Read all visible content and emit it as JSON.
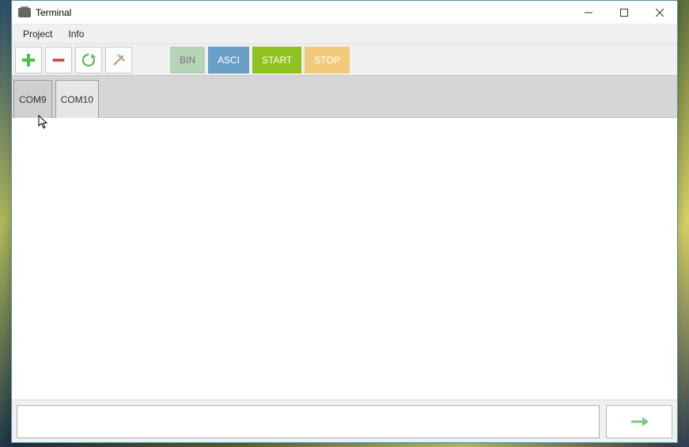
{
  "window": {
    "title": "Terminal"
  },
  "menu": {
    "project": "Project",
    "info": "Info"
  },
  "toolbar": {
    "add_icon": "plus-icon",
    "remove_icon": "minus-icon",
    "refresh_icon": "refresh-icon",
    "settings_icon": "wrench-icon",
    "bin": "BIN",
    "asci": "ASCI",
    "start": "START",
    "stop": "STOP"
  },
  "tabs": [
    {
      "label": "COM9",
      "active": true
    },
    {
      "label": "COM10",
      "active": false
    }
  ],
  "input": {
    "value": ""
  },
  "colors": {
    "bin": "#b5d3b5",
    "asci": "#6a9fc7",
    "start": "#8fc21e",
    "stop": "#f2ca7a"
  }
}
